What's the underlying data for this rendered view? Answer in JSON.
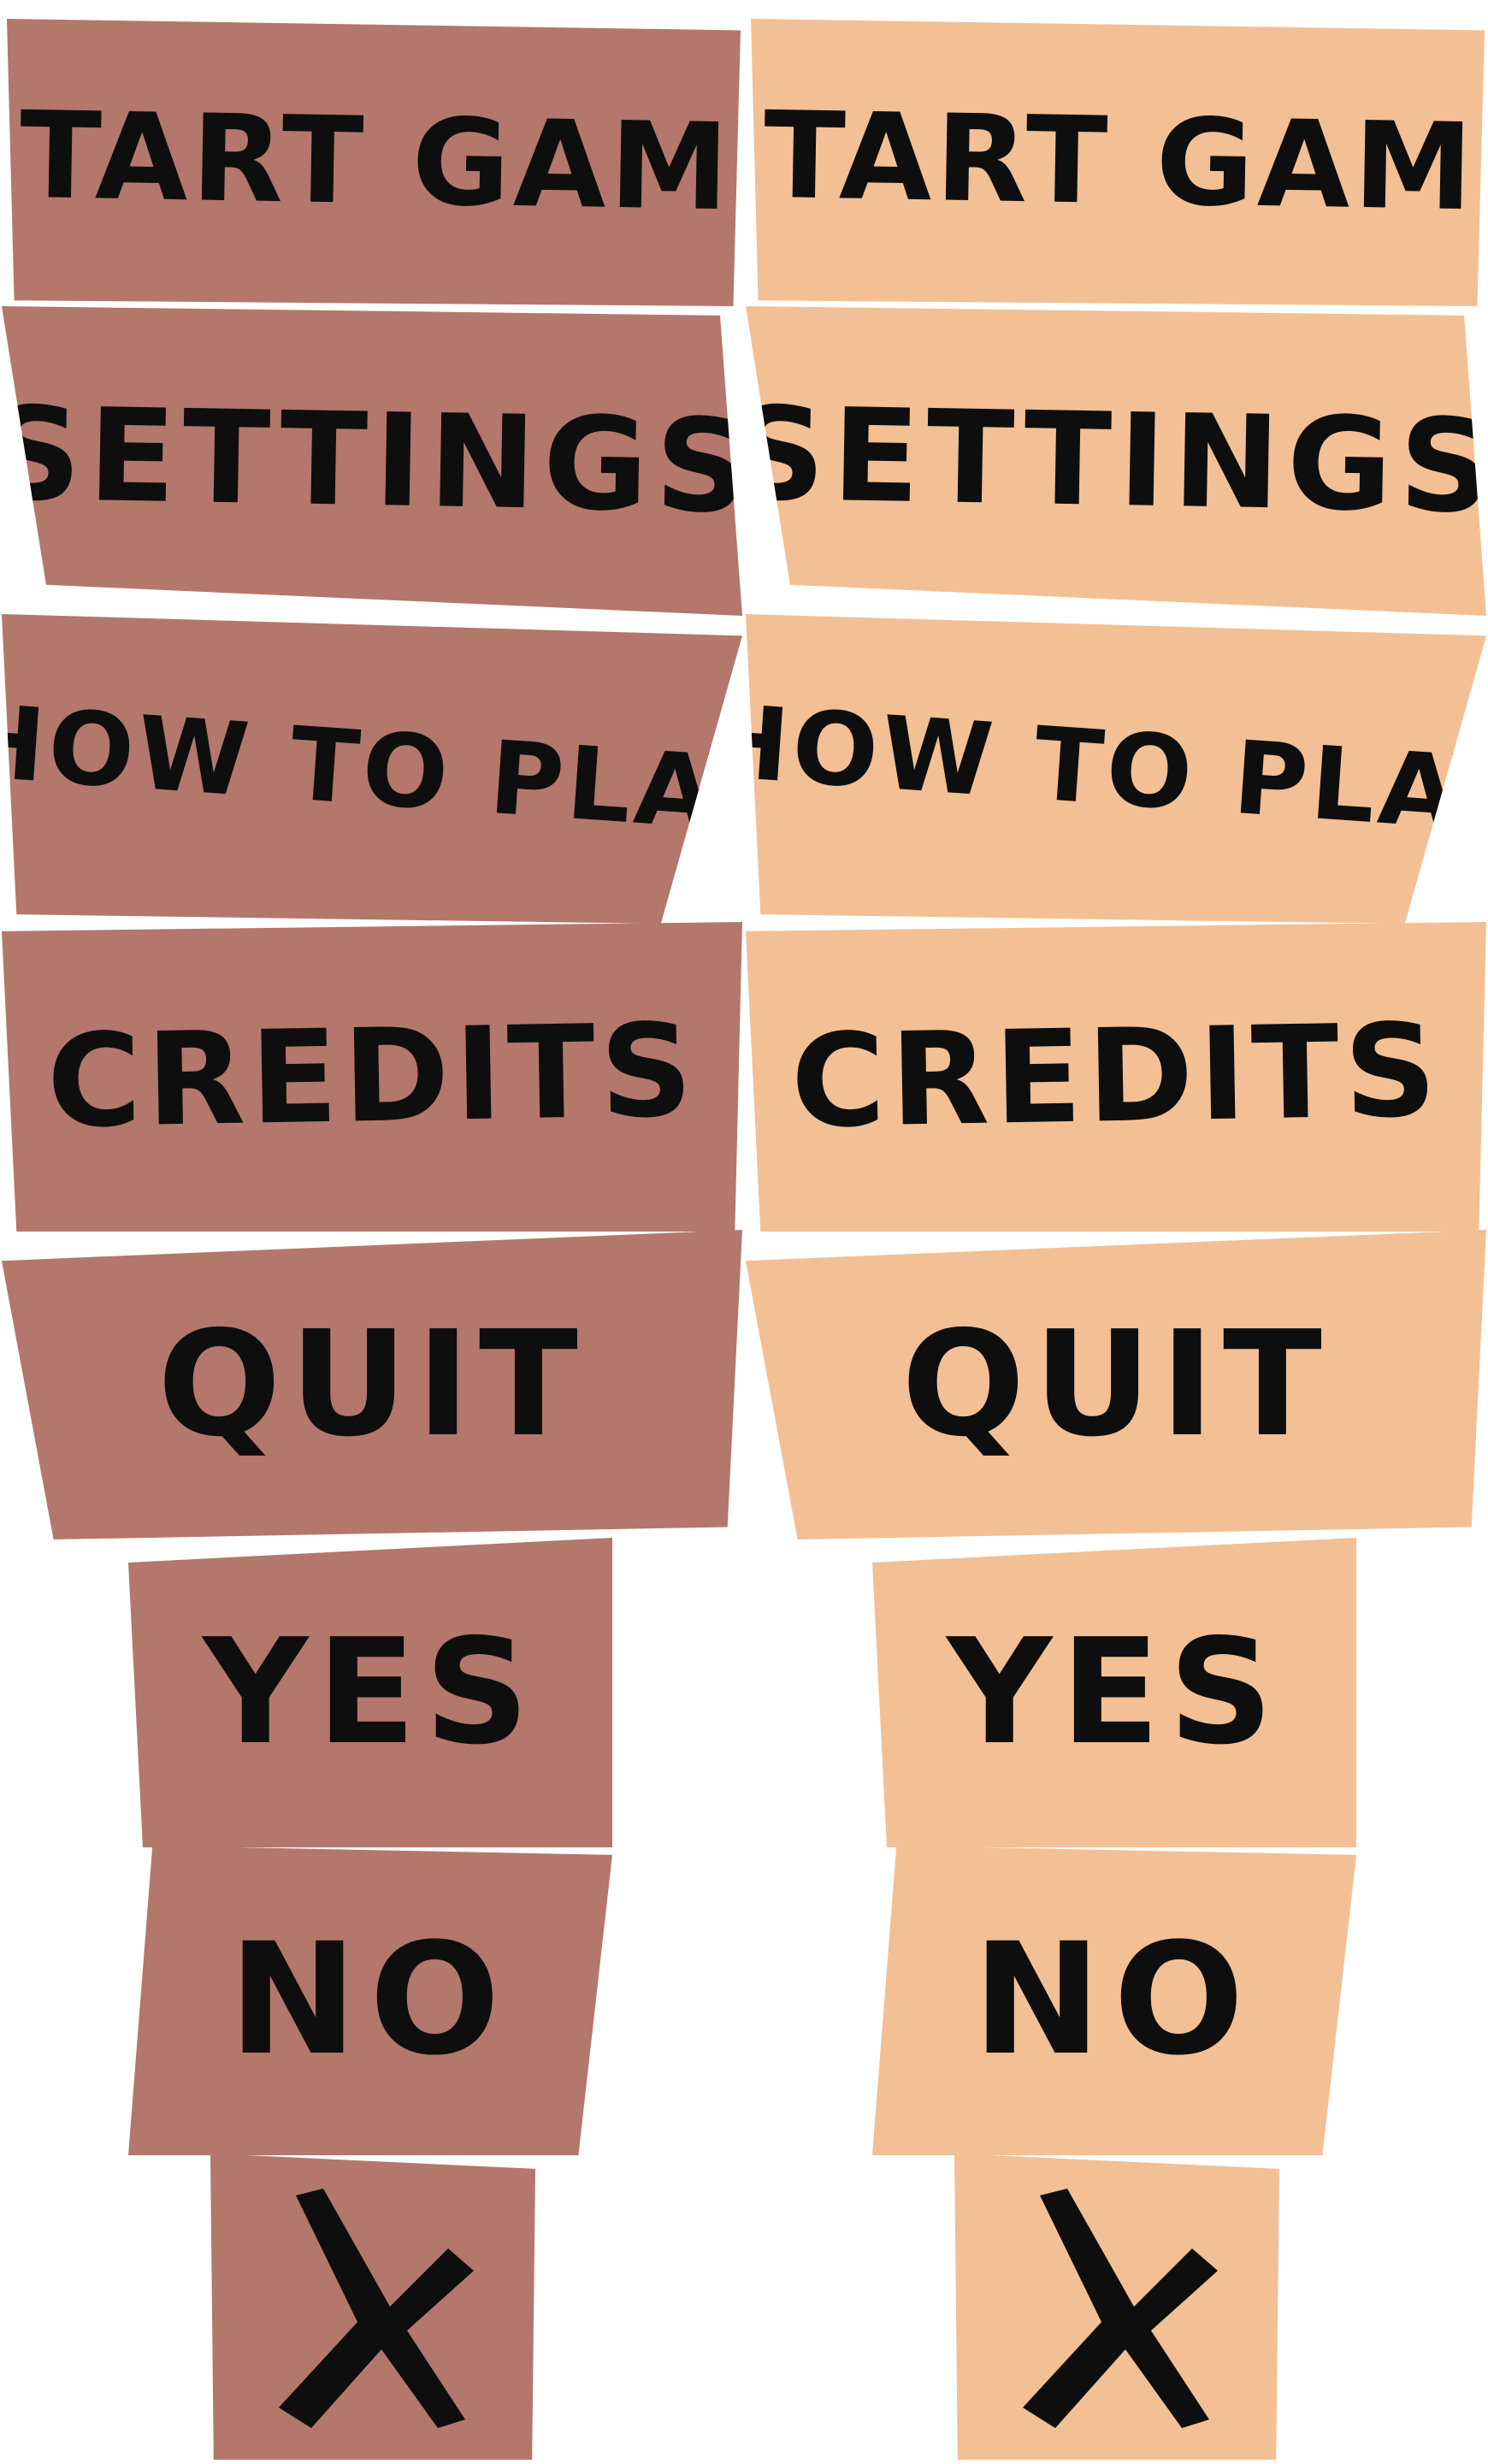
{
  "variants": [
    {
      "name": "dark",
      "fill_color": "#b3776b",
      "buttons": {
        "start_game": "START GAME",
        "settings": "SETTINGS",
        "how_to_play": "HOW TO PLAY",
        "credits": "CREDITS",
        "quit": "QUIT",
        "yes": "YES",
        "no": "NO"
      },
      "close_icon": "x-close-icon"
    },
    {
      "name": "light",
      "fill_color": "#f2c094",
      "buttons": {
        "start_game": "START GAME",
        "settings": "SETTINGS",
        "how_to_play": "HOW TO PLAY",
        "credits": "CREDITS",
        "quit": "QUIT",
        "yes": "YES",
        "no": "NO"
      },
      "close_icon": "x-close-icon"
    }
  ],
  "text_color": "#0e0e0e",
  "background_color": "#ffffff"
}
